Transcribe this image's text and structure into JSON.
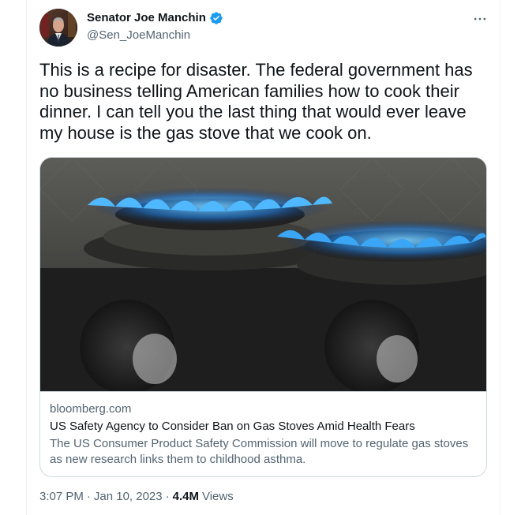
{
  "author": {
    "display_name": "Senator Joe Manchin",
    "handle": "@Sen_JoeManchin",
    "verified": true
  },
  "tweet": {
    "text": "This is a recipe for disaster. The federal government has no business telling American families how to cook their dinner. I can tell you the last thing that would ever leave my house is the gas stove that we cook on."
  },
  "card": {
    "domain": "bloomberg.com",
    "title": "US Safety Agency to Consider Ban on Gas Stoves Amid Health Fears",
    "description": "The US Consumer Product Safety Commission will move to regulate gas stoves as new research links them to childhood asthma."
  },
  "meta": {
    "time": "3:07 PM",
    "separator": "·",
    "date": "Jan 10, 2023",
    "views_count": "4.4M",
    "views_label": "Views"
  },
  "icons": {
    "verified": "verified-badge-icon",
    "more": "more-horizontal-icon"
  },
  "colors": {
    "verified_blue": "#1d9bf0",
    "secondary_text": "#536471",
    "primary_text": "#0f1419",
    "border": "#cfd9de"
  }
}
